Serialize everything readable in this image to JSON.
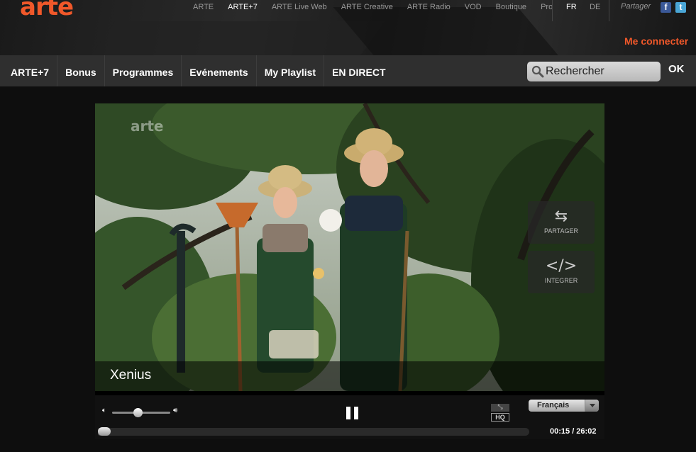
{
  "header": {
    "logo": "arte",
    "links": [
      "ARTE",
      "ARTE+7",
      "ARTE Live Web",
      "ARTE Creative",
      "ARTE Radio",
      "VOD",
      "Boutique",
      "Pro"
    ],
    "active_link": "ARTE+7",
    "lang_fr": "FR",
    "lang_de": "DE",
    "share_label": "Partager",
    "facebook_icon": "f",
    "twitter_icon": "t",
    "connect_label": "Me connecter",
    "accent_color": "#f0582a"
  },
  "nav": {
    "items": [
      "ARTE+7",
      "Bonus",
      "Programmes",
      "Evénements",
      "My Playlist",
      "EN DIRECT"
    ],
    "search_placeholder": "Rechercher",
    "ok_label": "OK"
  },
  "player": {
    "watermark": "arte",
    "title": "Xenius",
    "share_icon": "⇆",
    "share_label": "PARTAGER",
    "embed_icon": "</>",
    "embed_label": "INTEGRER",
    "hq_label": "HQ",
    "fullscreen_icon": "⤡",
    "language": "Français",
    "current_time": "00:15",
    "duration": "26:02",
    "time_display": "00:15 / 26:02",
    "volume_level": 0.45,
    "progress_fraction": 0.0096,
    "state": "playing"
  }
}
